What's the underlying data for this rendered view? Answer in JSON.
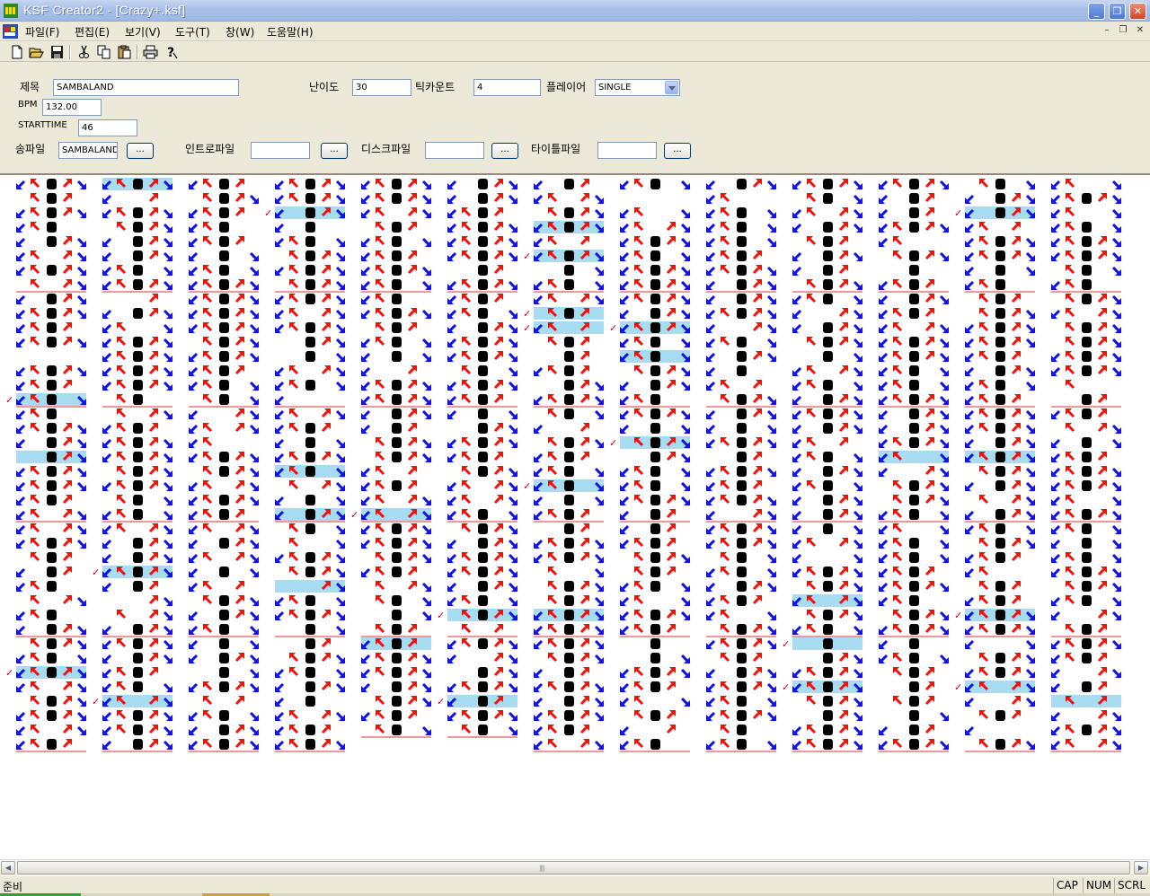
{
  "window": {
    "title": "KSF Creator2 - [Crazy+.ksf]",
    "minimize": "_",
    "maximize": "❐",
    "close": "✕"
  },
  "menu": [
    {
      "label": "파일(F)"
    },
    {
      "label": "편집(E)"
    },
    {
      "label": "보기(V)"
    },
    {
      "label": "도구(T)"
    },
    {
      "label": "창(W)"
    },
    {
      "label": "도움말(H)"
    }
  ],
  "mdi": {
    "minimize": "–",
    "restore": "❐",
    "close": "✕"
  },
  "toolbar": [
    "new-file-icon",
    "open-folder-icon",
    "save-icon",
    "cut-icon",
    "copy-icon",
    "paste-icon",
    "print-icon",
    "help-icon"
  ],
  "form": {
    "title_label": "제목",
    "title_value": "SAMBALAND",
    "bpm_label": "BPM",
    "bpm_value": "132.00",
    "starttime_label": "STARTTIME",
    "starttime_value": "46",
    "song_label": "송파일",
    "song_value": "SAMBALAND",
    "browse": "...",
    "difficulty_label": "난이도",
    "difficulty_value": "30",
    "tickcount_label": "틱카운트",
    "tickcount_value": "4",
    "player_label": "플레이어",
    "player_value": "SINGLE",
    "intro_label": "인트로파일",
    "intro_value": "",
    "disc_label": "디스크파일",
    "disc_value": "",
    "titlefile_label": "타이틀파일",
    "titlefile_value": ""
  },
  "chart_columns": 13,
  "colors": {
    "arrow_blue": "#1010e8",
    "arrow_red": "#f01010",
    "center_black": "#000000",
    "hold_band": "#a8dcf0",
    "measure_line": "#e03030",
    "check": "#d01010"
  },
  "status": {
    "ready": "준비",
    "cap": "CAP",
    "num": "NUM",
    "scrl": "SCRL"
  }
}
